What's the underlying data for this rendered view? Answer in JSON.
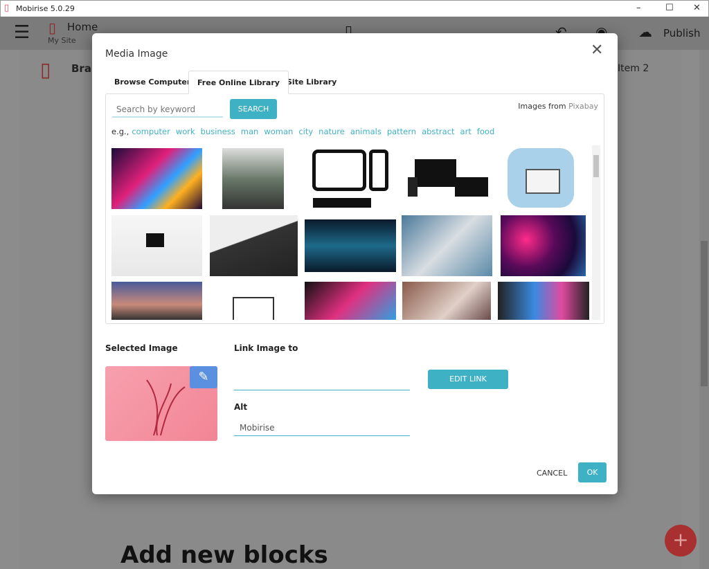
{
  "window": {
    "title": "Mobirise 5.0.29"
  },
  "app_toolbar": {
    "page": "Home",
    "site": "My Site",
    "publish": "Publish"
  },
  "background": {
    "brand": "Bran",
    "menu_item": "Item 2",
    "heading": "Add new blocks"
  },
  "modal": {
    "title": "Media Image",
    "tabs": [
      {
        "label": "Browse Computer"
      },
      {
        "label": "Free Online Library",
        "active": true
      },
      {
        "label": "Site Library"
      }
    ],
    "search": {
      "placeholder": "Search by keyword",
      "value": "",
      "button": "SEARCH"
    },
    "source_prefix": "Images from",
    "source_name": "Pixabay",
    "examples_prefix": "e.g.,",
    "keywords": [
      "computer",
      "work",
      "business",
      "man",
      "woman",
      "city",
      "nature",
      "animals",
      "pattern",
      "abstract",
      "art",
      "food"
    ],
    "selected_image_label": "Selected Image",
    "link_label": "Link Image to",
    "link_value": "",
    "edit_link": "EDIT LINK",
    "alt_label": "Alt",
    "alt_value": "Mobirise",
    "cancel": "CANCEL",
    "ok": "OK"
  },
  "colors": {
    "accent": "#3fb1c4",
    "fab": "#d33a3a",
    "edit_button": "#5b8fe0"
  }
}
